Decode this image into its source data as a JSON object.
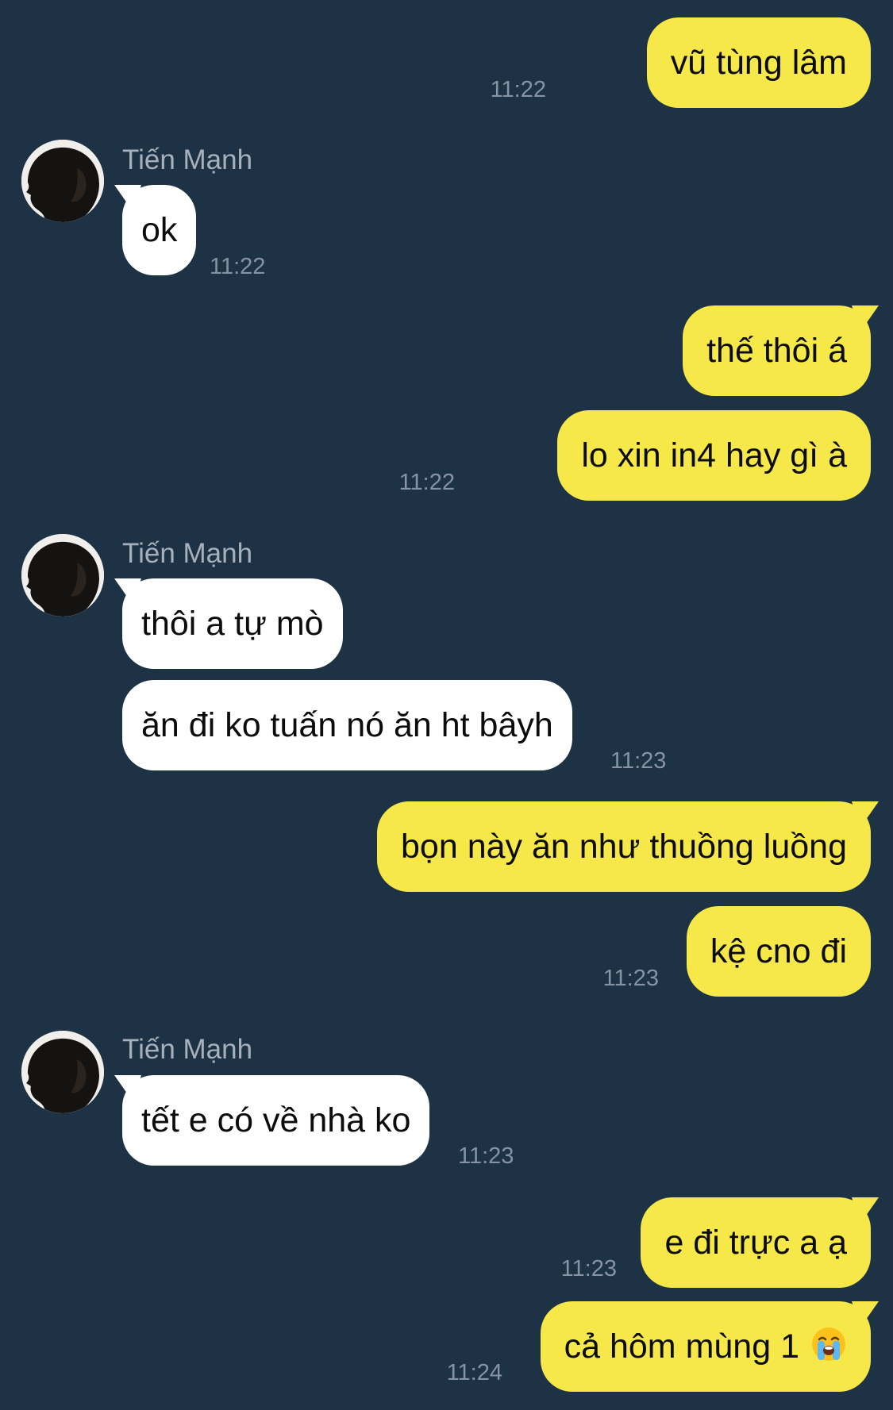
{
  "theme": {
    "background": "#1e3246",
    "my_bubble": "#f7e84a",
    "their_bubble": "#ffffff",
    "timestamp_color": "#8593a3",
    "sender_color": "#a7b0bb"
  },
  "contact": {
    "name": "Tiến Mạnh",
    "avatar_icon": "profile-silhouette-icon"
  },
  "messages": [
    {
      "from": "me",
      "text": "vũ tùng lâm",
      "time": "11:22"
    },
    {
      "from": "them",
      "sender": "Tiến Mạnh",
      "text": "ok",
      "time": "11:22"
    },
    {
      "from": "me",
      "text": "thế thôi á"
    },
    {
      "from": "me",
      "text": "lo xin in4 hay gì à",
      "time": "11:22"
    },
    {
      "from": "them",
      "sender": "Tiến Mạnh",
      "text": "thôi a tự mò"
    },
    {
      "from": "them",
      "text": "ăn đi ko tuấn nó ăn ht bâyh",
      "time": "11:23"
    },
    {
      "from": "me",
      "text": "bọn này ăn như thuồng luồng"
    },
    {
      "from": "me",
      "text": "kệ cno đi",
      "time": "11:23"
    },
    {
      "from": "them",
      "sender": "Tiến Mạnh",
      "text": "tết e có về nhà ko",
      "time": "11:23"
    },
    {
      "from": "me",
      "text": "e đi trực a ạ",
      "time": "11:23"
    },
    {
      "from": "me",
      "text": "cả hôm mùng 1",
      "emoji": "loudly-crying-face-icon",
      "time": "11:24"
    }
  ]
}
